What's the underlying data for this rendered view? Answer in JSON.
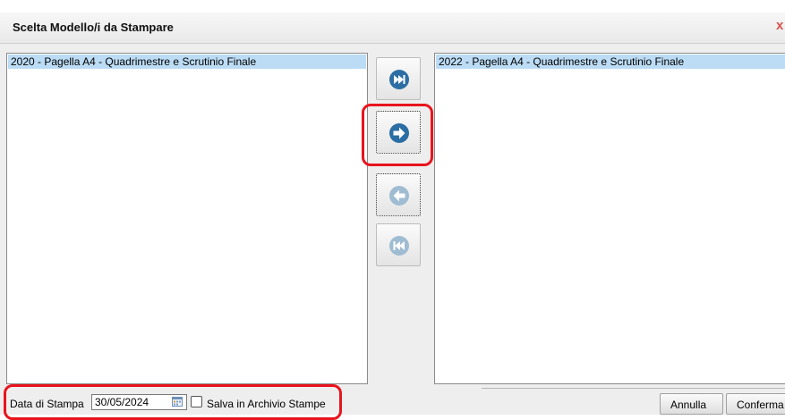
{
  "dialog": {
    "title": "Scelta Modello/i da Stampare",
    "close_glyph": "x"
  },
  "available_models": {
    "items": [
      {
        "label": "2020 - Pagella A4 - Quadrimestre e Scrutinio Finale",
        "selected": true
      }
    ]
  },
  "selected_models": {
    "items": [
      {
        "label": "2022 - Pagella A4 - Quadrimestre e Scrutinio Finale",
        "selected": true
      }
    ]
  },
  "move_buttons": [
    {
      "name": "move-all-right",
      "icon": "fast-forward-icon",
      "enabled": true
    },
    {
      "name": "move-right",
      "icon": "arrow-right-icon",
      "enabled": true,
      "highlighted": true
    },
    {
      "name": "move-left",
      "icon": "arrow-left-icon",
      "enabled": false
    },
    {
      "name": "move-all-left",
      "icon": "fast-rewind-icon",
      "enabled": false
    }
  ],
  "footer": {
    "date_label": "Data di Stampa",
    "date_value": "30/05/2024",
    "save_archive_label": "Salva in Archivio Stampe",
    "save_archive_checked": false,
    "cancel_label": "Annulla",
    "confirm_label": "Conferma"
  },
  "colors": {
    "highlight": "#e8141e",
    "icon_enabled": "#2c6ea3",
    "icon_disabled": "#9fbcd2",
    "list_selection": "#bcdcf5"
  }
}
